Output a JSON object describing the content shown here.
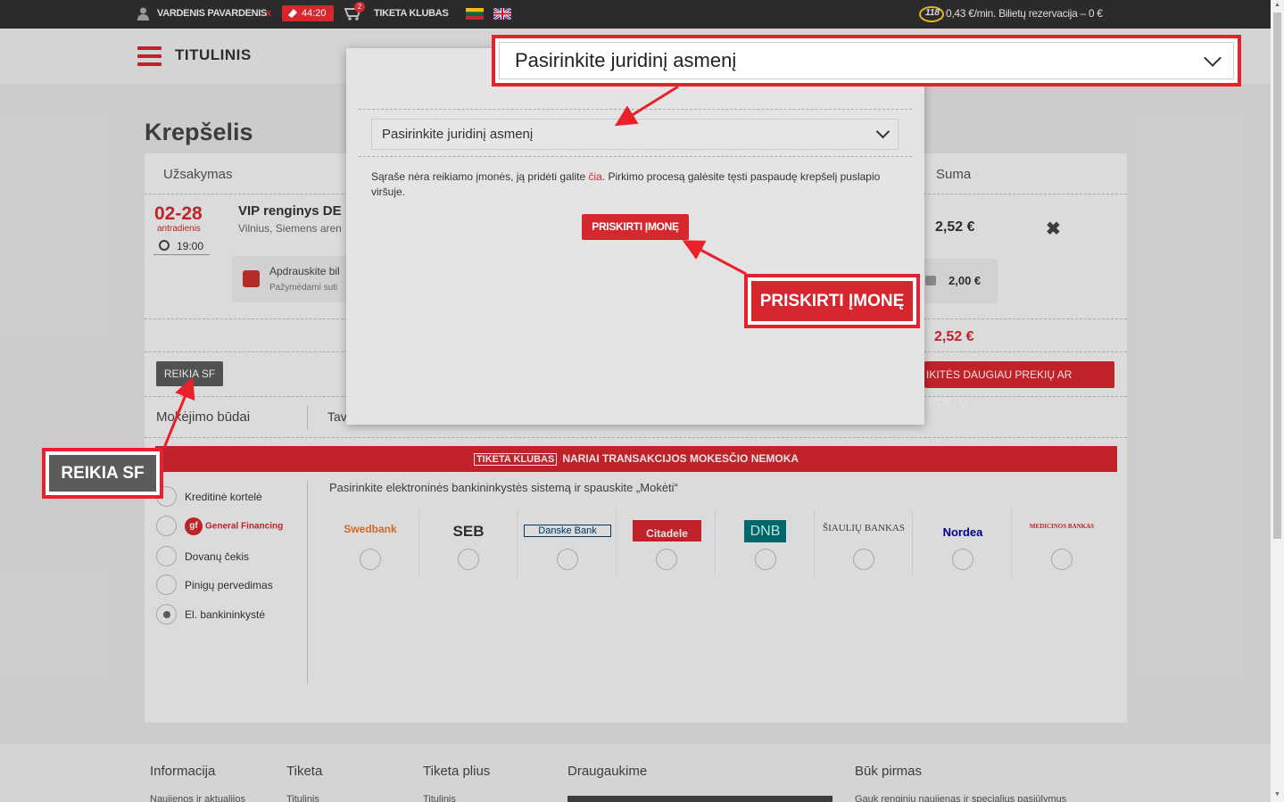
{
  "topbar": {
    "user_name": "VARDENIS PAVARDENIS",
    "logout": "x",
    "timer": "44:20",
    "cart_count": "2",
    "club": "TIKETA KLUBAS",
    "hotline": "118",
    "hotline_text": "0,43 €/min. Bilietų rezervacija – 0 €"
  },
  "header": {
    "logo": "TITULINIS"
  },
  "page": {
    "title": "Krepšelis"
  },
  "cart": {
    "col_order": "Užsakymas",
    "col_sum": "Suma",
    "date": "02-28",
    "weekday": "antradienis",
    "time": "19:00",
    "event_title": "VIP renginys DE",
    "event_subtitle": "Vilnius, Siemens aren",
    "insure_title": "Apdrauskite bil",
    "insure_sub": "Pažymėdami suti",
    "item_price": "2,52 €",
    "remove": "✖",
    "insure_price": "2,00 €",
    "total": "2,52 €",
    "need_invoice_btn": "REIKIA SF",
    "add_more_btn": "IKITĖS DAUGIAU PREKIŲ AR BILIETŲ"
  },
  "payment": {
    "title": "Mokėjimo būdai",
    "tab_partial": "Tav",
    "banner_logo": "TIKETA KLUBAS",
    "banner_text": "NARIAI TRANSAKCIJOS MOKESČIO NEMOKA",
    "methods": [
      "Kreditinė kortelė",
      "General Financing",
      "Dovanų čekis",
      "Pinigų pervedimas",
      "El. bankininkystė"
    ],
    "bank_hint": "Pasirinkite elektroninės bankininkystės sistemą ir spauskite „Mokėti“",
    "banks": [
      {
        "name": "Swedbank",
        "color": "#e6762a"
      },
      {
        "name": "SEB",
        "color": "#333333"
      },
      {
        "name": "Danske Bank",
        "color": "#003f6f"
      },
      {
        "name": "Citadele",
        "color": "#d6262e"
      },
      {
        "name": "DNB",
        "color": "#00737a"
      },
      {
        "name": "ŠIAULIŲ BANKAS",
        "color": "#444444"
      },
      {
        "name": "Nordea",
        "color": "#0000a0"
      },
      {
        "name": "MEDICINOS BANKAS",
        "color": "#d6262e"
      }
    ]
  },
  "footer": {
    "cols": [
      "Informacija",
      "Tiketa",
      "Tiketa plius",
      "Draugaukime",
      "Būk pirmas"
    ],
    "subs": [
      "Naujienos ir aktualijos",
      "Titulinis",
      "Titulinis",
      "Gauk renginių naujienas ir specialius pasiūlymus"
    ]
  },
  "modal": {
    "select_placeholder": "Pasirinkite juridinį asmenį",
    "text_before": "Sąraše nėra reikiamo įmonės, ją pridėti galite ",
    "link": "čia",
    "text_after": ". Pirkimo procesą galėsite tęsti paspaudę krepšelį puslapio viršuje.",
    "assign_btn": "PRISKIRTI ĮMONĘ"
  },
  "callouts": {
    "select": "Pasirinkite juridinį asmenį",
    "assign": "PRISKIRTI ĮMONĘ",
    "need_invoice": "REIKIA SF"
  },
  "colors": {
    "accent": "#d6262e",
    "callout": "#e8212b",
    "dark": "#2b2b2b"
  }
}
